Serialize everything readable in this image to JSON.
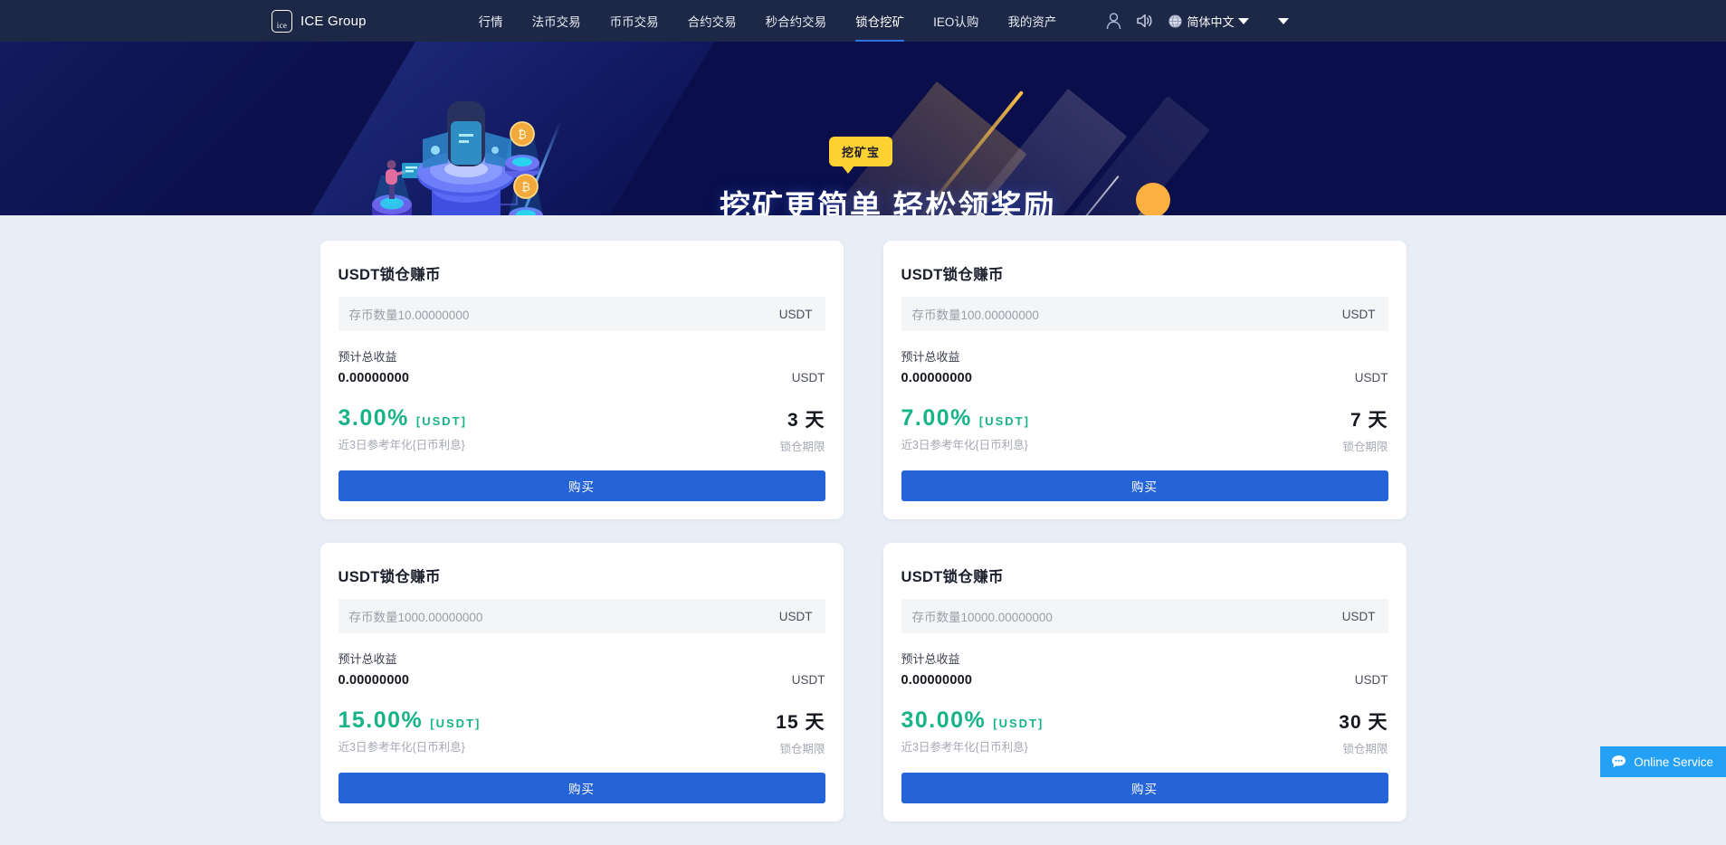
{
  "nav": {
    "logo_mark_text": "ice",
    "logo_text": "ICE Group",
    "items": [
      {
        "label": "行情",
        "active": false
      },
      {
        "label": "法币交易",
        "active": false
      },
      {
        "label": "币币交易",
        "active": false
      },
      {
        "label": "合约交易",
        "active": false
      },
      {
        "label": "秒合约交易",
        "active": false
      },
      {
        "label": "锁仓挖矿",
        "active": true
      },
      {
        "label": "IEO认购",
        "active": false
      },
      {
        "label": "我的资产",
        "active": false
      }
    ],
    "icons": {
      "user": "user-icon",
      "sound": "sound-icon",
      "globe": "globe-icon",
      "dropdown": "chevron-down-icon"
    },
    "language": "简体中文"
  },
  "banner": {
    "badge": "挖矿宝",
    "headline": "挖矿更简单 轻松领奖励",
    "bg_color": "#0a0e4a",
    "badge_color": "#ffd233",
    "ball_color": "#fbb040"
  },
  "cards": [
    {
      "title": "USDT锁仓赚币",
      "amount_placeholder": "存币数量10.00000000",
      "amount_unit": "USDT",
      "profit_label": "预计总收益",
      "profit_value": "0.00000000",
      "profit_unit": "USDT",
      "rate_pct": "3.00%",
      "rate_coin": "[USDT]",
      "rate_sub": "近3日参考年化{日币利息}",
      "term_days": "3 天",
      "term_label": "锁仓期限",
      "buy_label": "购买"
    },
    {
      "title": "USDT锁仓赚币",
      "amount_placeholder": "存币数量100.00000000",
      "amount_unit": "USDT",
      "profit_label": "预计总收益",
      "profit_value": "0.00000000",
      "profit_unit": "USDT",
      "rate_pct": "7.00%",
      "rate_coin": "[USDT]",
      "rate_sub": "近3日参考年化{日币利息}",
      "term_days": "7 天",
      "term_label": "锁仓期限",
      "buy_label": "购买"
    },
    {
      "title": "USDT锁仓赚币",
      "amount_placeholder": "存币数量1000.00000000",
      "amount_unit": "USDT",
      "profit_label": "预计总收益",
      "profit_value": "0.00000000",
      "profit_unit": "USDT",
      "rate_pct": "15.00%",
      "rate_coin": "[USDT]",
      "rate_sub": "近3日参考年化{日币利息}",
      "term_days": "15 天",
      "term_label": "锁仓期限",
      "buy_label": "购买"
    },
    {
      "title": "USDT锁仓赚币",
      "amount_placeholder": "存币数量10000.00000000",
      "amount_unit": "USDT",
      "profit_label": "预计总收益",
      "profit_value": "0.00000000",
      "profit_unit": "USDT",
      "rate_pct": "30.00%",
      "rate_coin": "[USDT]",
      "rate_sub": "近3日参考年化{日币利息}",
      "term_days": "30 天",
      "term_label": "锁仓期限",
      "buy_label": "购买"
    }
  ],
  "online_service": {
    "label": "Online Service",
    "icon": "chat-bubble-icon",
    "color": "#24a1f5"
  },
  "theme": {
    "nav_bg": "#1d2746",
    "page_bg": "#e9edf5",
    "accent_blue": "#2563d9",
    "accent_green": "#18b388"
  }
}
